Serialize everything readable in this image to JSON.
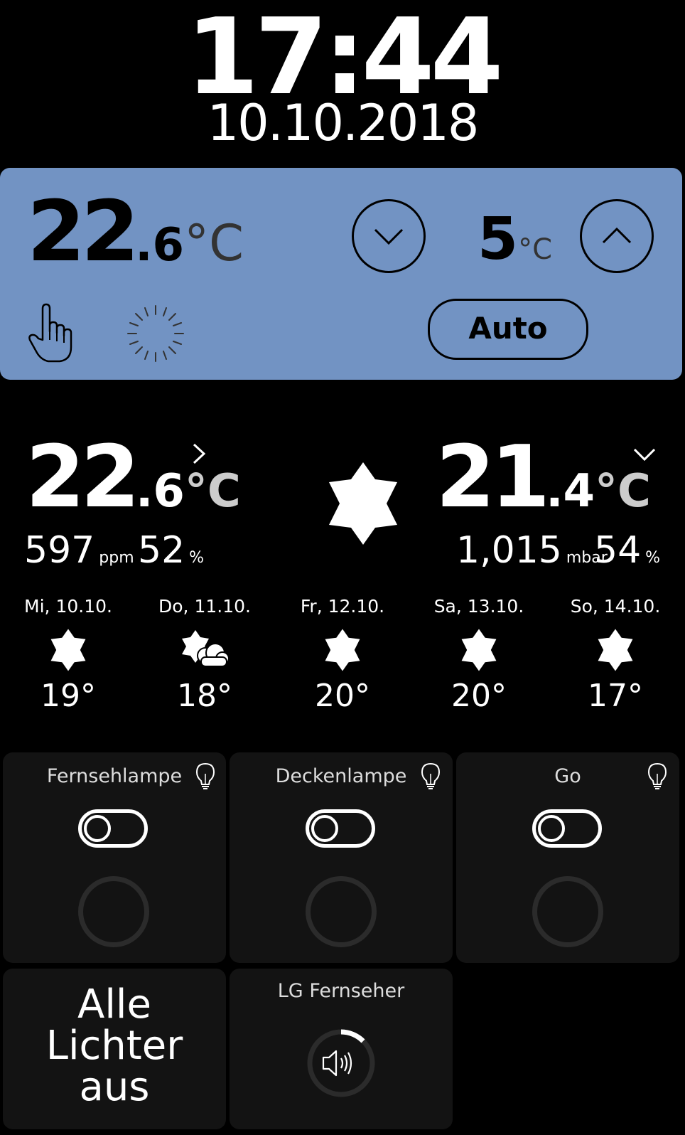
{
  "clock": {
    "time": "17:44",
    "date": "10.10.2018"
  },
  "thermostat": {
    "current_int": "22",
    "current_dec": ".6",
    "unit": "°C",
    "setpoint": "5",
    "setpoint_unit": "°C",
    "mode": "Auto",
    "colors": {
      "panel": "#7293c3"
    }
  },
  "weather": {
    "indoor": {
      "temp_int": "22",
      "temp_dec": ".6",
      "unit": "°C",
      "co2": "597",
      "co2_unit": "ppm",
      "humidity": "52",
      "humidity_unit": "%"
    },
    "outdoor": {
      "temp_int": "21",
      "temp_dec": ".4",
      "unit": "°C",
      "pressure": "1,015",
      "pressure_unit": "mbar",
      "humidity": "54",
      "humidity_unit": "%"
    },
    "current_icon": "sun-icon",
    "forecast": [
      {
        "label": "Mi, 10.10.",
        "icon": "sun-icon",
        "temp": "19°"
      },
      {
        "label": "Do, 11.10.",
        "icon": "partly-cloudy-icon",
        "temp": "18°"
      },
      {
        "label": "Fr, 12.10.",
        "icon": "sun-icon",
        "temp": "20°"
      },
      {
        "label": "Sa, 13.10.",
        "icon": "sun-icon",
        "temp": "20°"
      },
      {
        "label": "So, 14.10.",
        "icon": "sun-icon",
        "temp": "17°"
      }
    ]
  },
  "tiles": {
    "lamps": [
      {
        "title": "Fernsehlampe"
      },
      {
        "title": "Deckenlampe"
      },
      {
        "title": "Go"
      }
    ],
    "all_off": {
      "line1": "Alle",
      "line2": "Lichter",
      "line3": "aus"
    },
    "tv": {
      "title": "LG Fernseher",
      "icon": "speaker-icon"
    }
  }
}
